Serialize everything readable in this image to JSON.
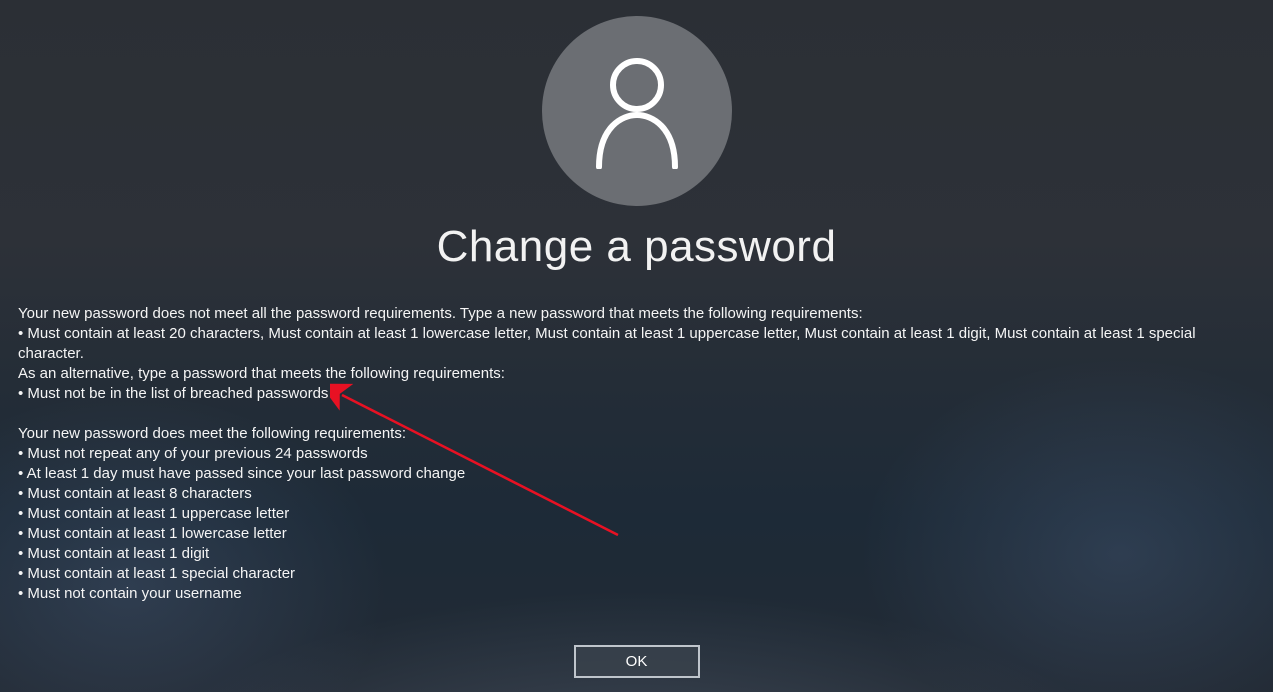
{
  "title": "Change a password",
  "message": {
    "intro": "Your new password does not meet all the password requirements. Type a new password that meets the following requirements:",
    "primary_requirements": [
      "Must contain at least 20 characters, Must contain at least 1 lowercase letter, Must contain at least 1 uppercase letter, Must contain at least 1 digit, Must contain at least 1 special character."
    ],
    "alternative_intro": "As an alternative, type a password that meets the following requirements:",
    "alternative_requirements": [
      "Must not be in the list of breached passwords"
    ],
    "met_intro": "Your new password does meet the following requirements:",
    "met_requirements": [
      "Must not repeat any of your previous 24 passwords",
      "At least 1 day must have passed since your last password change",
      "Must contain at least 8 characters",
      "Must contain at least 1 uppercase letter",
      "Must contain at least 1 lowercase letter",
      "Must contain at least 1 digit",
      "Must contain at least 1 special character",
      "Must not contain your username"
    ]
  },
  "buttons": {
    "ok": "OK"
  }
}
